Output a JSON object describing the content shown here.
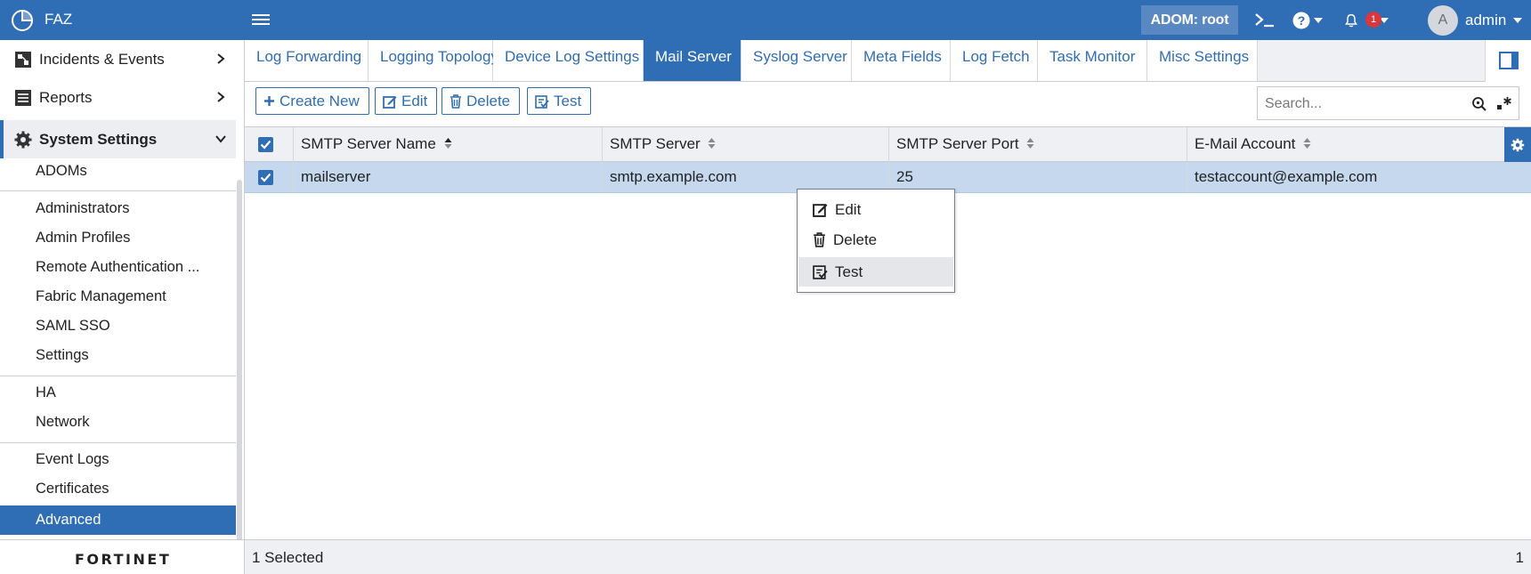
{
  "topbar": {
    "app_name": "FAZ",
    "adom_label": "ADOM: root",
    "notification_count": "1",
    "avatar_initial": "A",
    "username": "admin"
  },
  "sidebar": {
    "main_items": [
      {
        "label": "Incidents & Events",
        "icon": "incidents-icon"
      },
      {
        "label": "Reports",
        "icon": "reports-icon"
      },
      {
        "label": "System Settings",
        "icon": "gear-icon"
      }
    ],
    "sub_items": [
      "ADOMs",
      "Administrators",
      "Admin Profiles",
      "Remote Authentication ...",
      "Fabric Management",
      "SAML SSO",
      "Settings",
      "HA",
      "Network",
      "Event Logs",
      "Certificates",
      "Advanced"
    ],
    "brand": "FORTINET"
  },
  "tabs": [
    "Log Forwarding",
    "Logging Topology",
    "Device Log Settings",
    "Mail Server",
    "Syslog Server",
    "Meta Fields",
    "Log Fetch",
    "Task Monitor",
    "Misc Settings"
  ],
  "active_tab": "Mail Server",
  "toolbar": {
    "create_new": "Create New",
    "edit": "Edit",
    "delete": "Delete",
    "test": "Test",
    "search_placeholder": "Search..."
  },
  "table": {
    "columns": [
      "SMTP Server Name",
      "SMTP Server",
      "SMTP Server Port",
      "E-Mail Account"
    ],
    "rows": [
      {
        "name": "mailserver",
        "server": "smtp.example.com",
        "port": "25",
        "account": "testaccount@example.com",
        "selected": true
      }
    ]
  },
  "context_menu": {
    "items": [
      "Edit",
      "Delete",
      "Test"
    ],
    "highlighted": "Test"
  },
  "status": {
    "selected_text": "1 Selected",
    "total": "1"
  },
  "colors": {
    "accent": "#2f6db5",
    "selected_row": "#c5d8ee",
    "badge": "#d9363e"
  }
}
